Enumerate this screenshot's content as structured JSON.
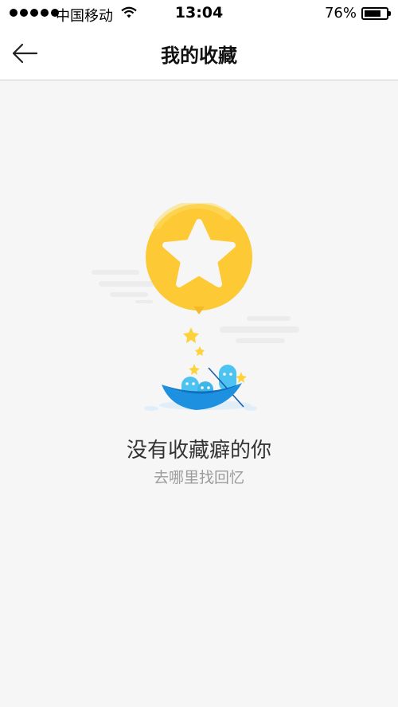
{
  "status_bar": {
    "carrier": "中国移动",
    "time": "13:04",
    "battery_percent": "76%",
    "battery_level": 0.76
  },
  "nav": {
    "back_icon": "arrow-left-icon",
    "title": "我的收藏"
  },
  "empty_state": {
    "illustration_icon": "star-balloon-boat-icon",
    "title": "没有收藏癖的你",
    "link": "去哪里找回忆"
  },
  "colors": {
    "background": "#f6f6f6",
    "balloon": "#fdc934",
    "boat": "#1e90e0",
    "ghost": "#4cc3f0",
    "star": "#fdd23a"
  }
}
